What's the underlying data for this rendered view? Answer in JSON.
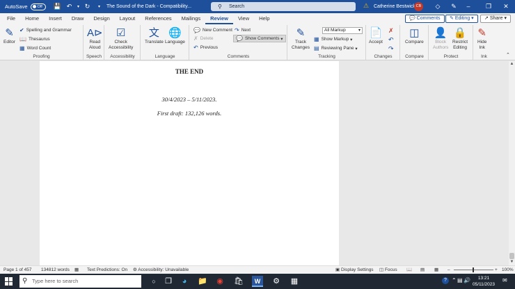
{
  "titlebar": {
    "autosave_label": "AutoSave",
    "autosave_state": "Off",
    "doc_title": "The Sound of the Dark  -  Compatibility...",
    "search_placeholder": "Search",
    "user_name": "Catherine Bestwick",
    "user_initials": "CB"
  },
  "menu": {
    "tabs": [
      "File",
      "Home",
      "Insert",
      "Draw",
      "Design",
      "Layout",
      "References",
      "Mailings",
      "Review",
      "View",
      "Help"
    ],
    "active_tab": "Review",
    "comments_btn": "Comments",
    "editing_btn": "Editing",
    "share_btn": "Share"
  },
  "ribbon": {
    "proofing": {
      "label": "Proofing",
      "editor": "Editor",
      "spelling": "Spelling and Grammar",
      "thesaurus": "Thesaurus",
      "word_count": "Word Count"
    },
    "speech": {
      "label": "Speech",
      "read_aloud_1": "Read",
      "read_aloud_2": "Aloud"
    },
    "accessibility": {
      "label": "Accessibility",
      "check_1": "Check",
      "check_2": "Accessibility"
    },
    "language": {
      "label": "Language",
      "translate": "Translate",
      "language": "Language"
    },
    "comments": {
      "label": "Comments",
      "new_comment": "New Comment",
      "delete": "Delete",
      "previous": "Previous",
      "next": "Next",
      "show_comments": "Show Comments"
    },
    "tracking": {
      "label": "Tracking",
      "track_changes_1": "Track",
      "track_changes_2": "Changes",
      "markup_select": "All Markup",
      "show_markup": "Show Markup",
      "reviewing_pane": "Reviewing Pane"
    },
    "changes": {
      "label": "Changes",
      "accept": "Accept"
    },
    "compare": {
      "label": "Compare",
      "compare": "Compare"
    },
    "protect": {
      "label": "Protect",
      "block_1": "Block",
      "block_2": "Authors",
      "restrict_1": "Restrict",
      "restrict_2": "Editing"
    },
    "ink": {
      "label": "Ink",
      "hide_1": "Hide",
      "hide_2": "Ink"
    }
  },
  "document": {
    "heading": "THE END",
    "dates": "30/4/2023 – 5/11/2023.",
    "draft": "First draft: 132,126 words."
  },
  "statusbar": {
    "page": "Page 1 of 457",
    "words": "134812 words",
    "text_predictions": "Text Predictions: On",
    "accessibility": "Accessibility: Unavailable",
    "display_settings": "Display Settings",
    "focus": "Focus",
    "zoom": "100%"
  },
  "taskbar": {
    "search_placeholder": "Type here to search",
    "time": "13:21",
    "date": "05/11/2023"
  }
}
